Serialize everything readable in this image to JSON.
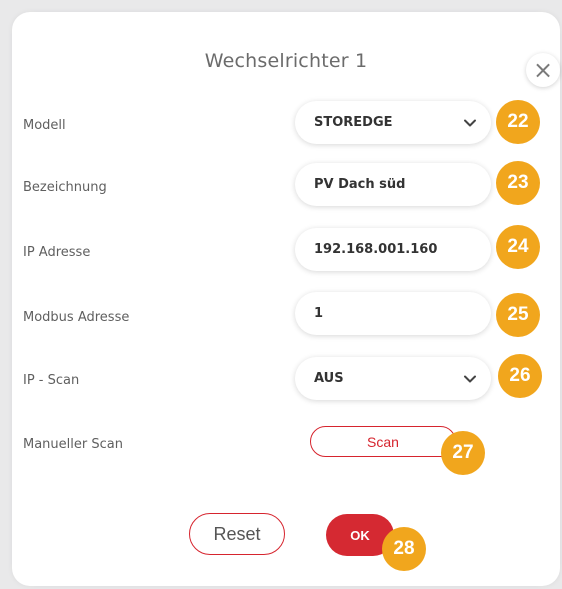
{
  "dialog": {
    "title": "Wechselrichter 1",
    "close_label": "×"
  },
  "fields": {
    "modell": {
      "label": "Modell",
      "value": "STOREDGE",
      "badge": "22"
    },
    "bezeichnung": {
      "label": "Bezeichnung",
      "value": "PV Dach süd",
      "badge": "23"
    },
    "ip_adresse": {
      "label": "IP Adresse",
      "value": "192.168.001.160",
      "badge": "24"
    },
    "modbus_adresse": {
      "label": "Modbus Adresse",
      "value": "1",
      "badge": "25"
    },
    "ip_scan": {
      "label": "IP - Scan",
      "value": "AUS",
      "badge": "26"
    }
  },
  "manual_scan": {
    "label": "Manueller Scan",
    "button": "Scan",
    "badge": "27"
  },
  "footer": {
    "reset": "Reset",
    "ok": "OK",
    "badge": "28"
  },
  "colors": {
    "accent": "#d52932",
    "badge": "#f1a61d",
    "text": "#5f5f5f"
  },
  "icons": {
    "close": "close-icon",
    "dropdown": "chevron-down-icon"
  }
}
